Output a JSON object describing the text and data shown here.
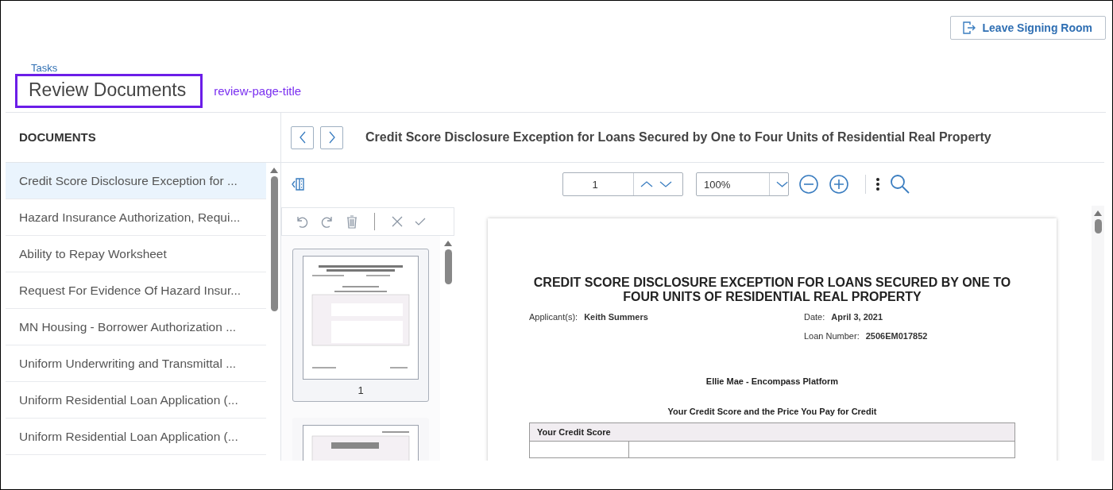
{
  "header": {
    "leave_button": "Leave Signing Room"
  },
  "breadcrumb": "Tasks",
  "page_title": "Review Documents",
  "annotation": {
    "label": "review-page-title"
  },
  "documents": {
    "heading": "DOCUMENTS",
    "items": [
      {
        "label": "Credit Score Disclosure Exception for ...",
        "selected": true
      },
      {
        "label": "Hazard Insurance Authorization, Requi...",
        "selected": false
      },
      {
        "label": "Ability to Repay Worksheet",
        "selected": false
      },
      {
        "label": "Request For Evidence Of Hazard Insur...",
        "selected": false
      },
      {
        "label": "MN Housing - Borrower Authorization ...",
        "selected": false
      },
      {
        "label": "Uniform Underwriting and Transmittal ...",
        "selected": false
      },
      {
        "label": "Uniform Residential Loan Application (...",
        "selected": false
      },
      {
        "label": "Uniform Residential Loan Application (...",
        "selected": false
      }
    ]
  },
  "viewer": {
    "title": "Credit Score Disclosure Exception for Loans Secured by One to Four Units of Residential Real Property",
    "page_field": "1",
    "zoom_field": "100%",
    "thumbnails": [
      {
        "label": "1",
        "selected": true
      },
      {
        "selected": false
      }
    ]
  },
  "document": {
    "title": "CREDIT SCORE DISCLOSURE EXCEPTION FOR LOANS SECURED BY ONE TO FOUR UNITS OF RESIDENTIAL REAL PROPERTY",
    "applicant": {
      "label": "Applicant(s):",
      "value": "Keith Summers"
    },
    "date": {
      "label": "Date:",
      "value": "April 3, 2021"
    },
    "loan_number": {
      "label": "Loan Number:",
      "value": "2506EM017852"
    },
    "organization": "Ellie Mae - Encompass Platform",
    "subtitle": "Your Credit Score and the Price You Pay for Credit",
    "table_heading": "Your Credit Score"
  }
}
